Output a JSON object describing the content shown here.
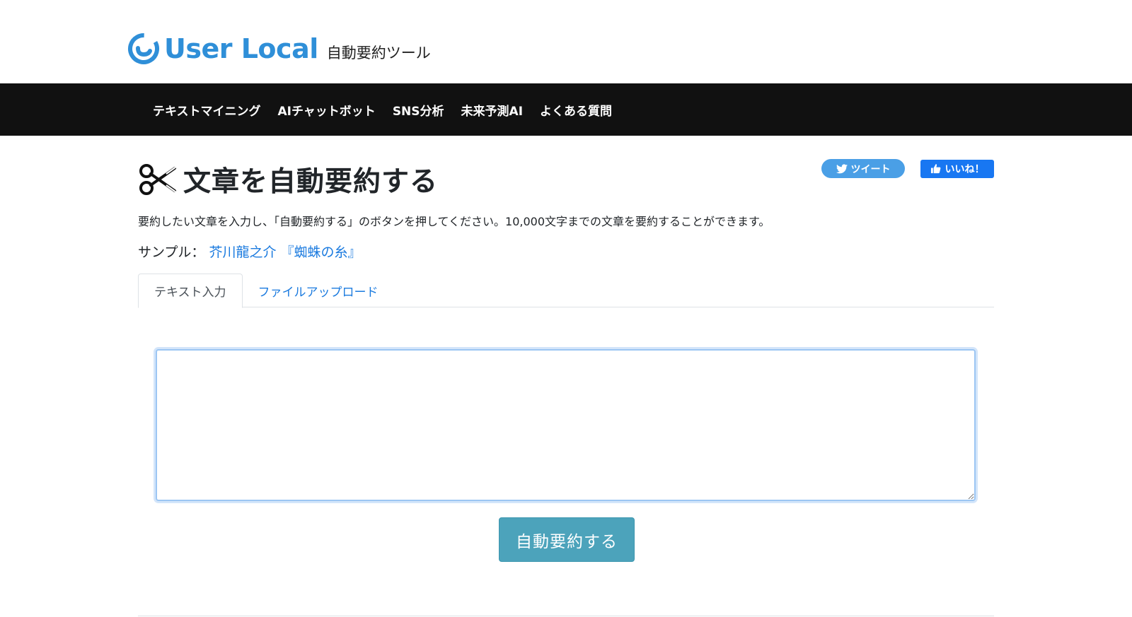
{
  "brand": {
    "name": "User Local",
    "tool_name": "自動要約ツール",
    "color": "#2f8fd8"
  },
  "nav": {
    "items": [
      {
        "label": "テキストマイニング"
      },
      {
        "label": "AIチャットボット"
      },
      {
        "label": "SNS分析"
      },
      {
        "label": "未来予測AI"
      },
      {
        "label": "よくある質問"
      }
    ]
  },
  "main": {
    "title": "文章を自動要約する",
    "title_icon": "scissors-icon",
    "description": "要約したい文章を入力し、「自動要約する」のボタンを押してください。10,000文字までの文章を要約することができます。",
    "sample_label": "サンプル：",
    "sample_link": "芥川龍之介 『蜘蛛の糸』"
  },
  "social": {
    "tweet_label": "ツイート",
    "like_label": "いいね！",
    "tweet_color": "#4a9fe6",
    "like_color": "#1877f2"
  },
  "tabs": [
    {
      "label": "テキスト入力",
      "active": true
    },
    {
      "label": "ファイルアップロード",
      "active": false
    }
  ],
  "input": {
    "value": "",
    "placeholder": ""
  },
  "submit": {
    "label": "自動要約する",
    "color": "#4ca3bb"
  }
}
